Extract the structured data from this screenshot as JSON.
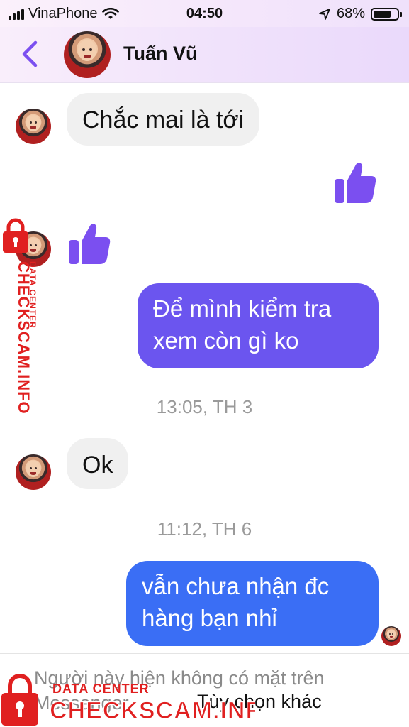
{
  "status_bar": {
    "carrier": "VinaPhone",
    "time": "04:50",
    "battery": "68%"
  },
  "header": {
    "name": "Tuấn Vũ"
  },
  "messages": {
    "m1": "Chắc mai là tới",
    "m4_line1": "Để mình kiểm tra",
    "m4_line2": "xem còn gì ko",
    "m5": "Ok",
    "m6_line1": "vẫn chưa nhận đc",
    "m6_line2": "hàng bạn nhỉ"
  },
  "timestamps": {
    "t1": "13:05, TH 3",
    "t2": "11:12, TH 6"
  },
  "footer": {
    "notice": "Người này hiện không có mặt trên Messenger.",
    "options_link": "Tùy chọn khác"
  },
  "watermark": {
    "top": "DATA CENTER",
    "brand": "CHECKSCAM.INFO"
  },
  "colors": {
    "accent_purple": "#7b4ff0",
    "bubble_purple": "#6b55ef",
    "bubble_blue": "#3a6ef5",
    "bubble_in": "#f0f0f0",
    "watermark_red": "#e02020"
  },
  "icons": [
    "back-chevron-icon",
    "like-thumb-icon",
    "wifi-icon",
    "location-arrow-icon",
    "battery-icon",
    "lock-icon"
  ]
}
